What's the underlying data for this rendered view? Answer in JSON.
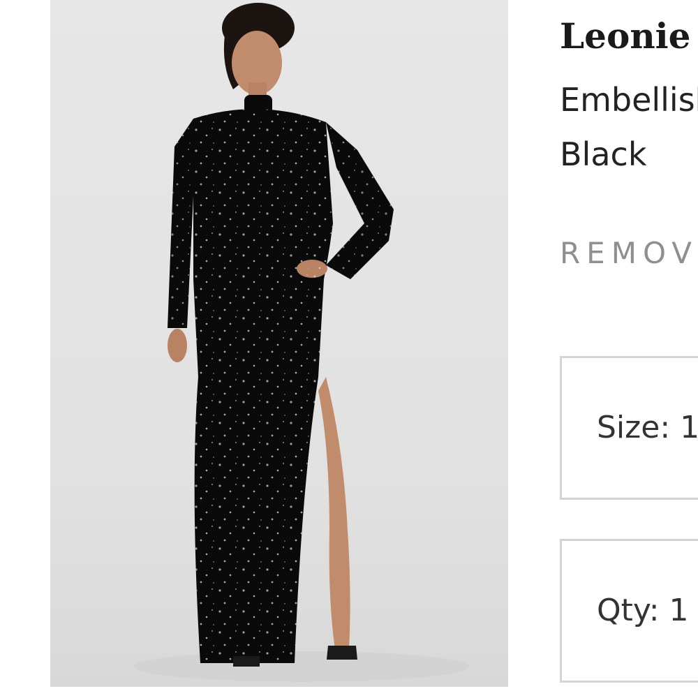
{
  "product": {
    "image_alt": "Model wearing black embellished long-sleeve maxi dress with thigh split",
    "name": "Leonie",
    "description_line1": "Embellished",
    "description_line2": "Black"
  },
  "actions": {
    "remove_label": "REMOVE"
  },
  "selectors": {
    "size_label": "Size: 1",
    "qty_label": "Qty: 1"
  },
  "colors": {
    "border": "#d4d4d4",
    "remove_text": "#8f8f8f",
    "dress": "#0a0a0a"
  }
}
